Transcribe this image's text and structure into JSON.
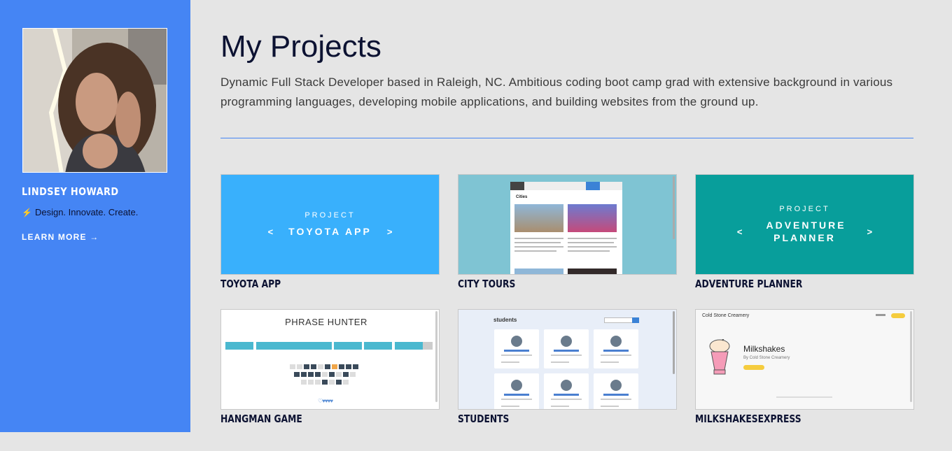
{
  "sidebar": {
    "name": "LINDSEY HOWARD",
    "tagline": "Design. Innovate. Create.",
    "learn_more": "LEARN MORE →",
    "bolt_icon": "⚡"
  },
  "main": {
    "title": "My Projects",
    "intro": "Dynamic Full Stack Developer based in Raleigh, NC. Ambitious coding boot camp grad with extensive background in various programming languages, developing mobile applications, and building websites from the ground up."
  },
  "projects": [
    {
      "title": "TOYOTA APP",
      "banner_pre": "PROJECT",
      "banner_name": "TOYOTA APP",
      "color": "#39b0fc"
    },
    {
      "title": "CITY TOURS",
      "section": "Cities"
    },
    {
      "title": "ADVENTURE PLANNER",
      "banner_pre": "PROJECT",
      "banner_name": "ADVENTURE PLANNER",
      "color": "#089e9b"
    },
    {
      "title": "HANGMAN GAME",
      "heading": "PHRASE HUNTER"
    },
    {
      "title": "STUDENTS",
      "heading": "students"
    },
    {
      "title": "MILKSHAKESEXPRESS",
      "brand": "Cold Stone Creamery",
      "heading": "Milkshakes",
      "sub": "By Cold Stone Creamery"
    }
  ],
  "colors": {
    "sidebar": "#4585f4",
    "background": "#e5e5e5",
    "title": "#0c1232"
  }
}
